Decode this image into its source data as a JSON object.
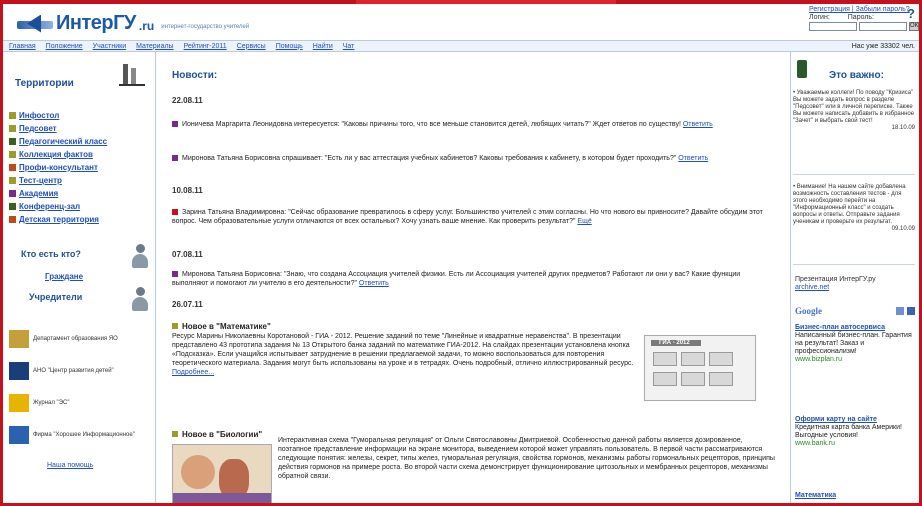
{
  "header": {
    "logo_text": "ИнтерГУ",
    "logo_tld": ".ru",
    "tagline": "интернет-государство учителей",
    "login": {
      "register_link": "Регистрация | Забыли пароль?",
      "login_label": "Логин:",
      "password_label": "Пароль:",
      "go_label": "OK"
    },
    "help_icon": "?"
  },
  "nav": {
    "items": [
      "Главная",
      "Положение",
      "Участники",
      "Материалы",
      "Рейтинг-2011",
      "Сервисы",
      "Помощь",
      "Найти",
      "Чат"
    ],
    "time": "Нас уже 33302 чел."
  },
  "left": {
    "territories_title": "Территории",
    "menu": [
      {
        "label": "Инфостол",
        "color": "#9c9c2a"
      },
      {
        "label": "Педсовет",
        "color": "#9c9c2a"
      },
      {
        "label": "Педагогический класс",
        "color": "#3b5f1e"
      },
      {
        "label": "Коллекция фактов",
        "color": "#9c9c2a"
      },
      {
        "label": "Профи-консультант",
        "color": "#c04a1a"
      },
      {
        "label": "Тест-центр",
        "color": "#9c9c2a"
      },
      {
        "label": "Академия",
        "color": "#7a2a8a"
      },
      {
        "label": "Конференц-зал",
        "color": "#3b5f1e"
      },
      {
        "label": "Детская территория",
        "color": "#c04a1a"
      }
    ],
    "who_is_who": "Кто есть кто?",
    "citizens": "Граждане",
    "founders": "Учредители",
    "partners": [
      {
        "text": "Департамент образования ЯО",
        "logo_color": "#c4a03a"
      },
      {
        "text": "АНО \"Центр развития детей\"",
        "logo_color": "#1b3d7a"
      },
      {
        "text": "Журнал \"ЭС\"",
        "logo_color": "#e8b400"
      },
      {
        "text": "Фирма \"Хорошее Информационное\"",
        "logo_color": "#2a62b0"
      }
    ],
    "help_link": "Наша помощь"
  },
  "main": {
    "news_title": "Новости:",
    "dates": [
      "22.08.11",
      "10.08.11",
      "07.08.11",
      "26.07.11"
    ],
    "items": [
      {
        "text": "Ионичева Маргарита Леонидовна интересуется: \"Каковы причины того, что все меньше становится детей, любящих читать?\" Ждет ответов по существу!",
        "link": "Ответить",
        "color": "#7a2a8a"
      },
      {
        "text": "Миронова Татьяна Борисовна спрашивает: \"Есть ли у вас аттестация учебных кабинетов? Каковы требования к кабинету, в котором будет проходить?\"",
        "link": "Ответить",
        "color": "#7a2a8a"
      },
      {
        "text": "Зарина Татьяна Владимировна: \"Сейчас образование превратилось в сферу услуг. Большинство учителей с этим согласны. Но что нового вы привносите? Давайте обсудим этот вопрос. Чем образовательные услуги отличаются от всех остальных? Хочу узнать ваше мнение. Как проверить результат?\"",
        "link": "Ещё",
        "color": "#c4121c"
      },
      {
        "text": "Миронова Татьяна Борисовна: \"Знаю, что создана Ассоциация учителей физики. Есть ли Ассоциация учителей других предметов? Работают ли они у вас? Какие функции выполняют и помогают ли учителю в его деятельности?\"",
        "link": "Ответить",
        "color": "#7a2a8a"
      }
    ],
    "novelty1": {
      "title": "Новое в \"Математике\"",
      "text": "Ресурс Марины Николаевны Коротановой - ГИА - 2012. Решение заданий по теме \"Линейные и квадратные неравенства\". В презентации представлено 43 прототипа задания № 13 Открытого банка заданий по математике ГИА-2012. На слайдах презентации установлена кнопка «Подсказка». Если учащийся испытывает затруднение в решении предлагаемой задачи, то можно воспользоваться для повторения теоретического материала. Задания могут быть использованы на уроке и в тетрадях. Очень подробный, отлично иллюстрированный ресурс.",
      "link": "Подробнее...",
      "thumb_title": "ГИА - 2012"
    },
    "novelty2": {
      "title": "Новое в \"Биологии\"",
      "text": "Интерактивная схема \"Гуморальная регуляция\" от Ольги Святославовны Дмитриевой. Особенностью данной работы является дозированное, поэтапное представление информации на экране монитора, выведением которой может управлять пользователь. В первой части рассматриваются следующие понятия: железы, секрет, типы желез, гуморальная регуляция, свойства гормонов, механизмы работы гормональных рецепторов, принципы действия гормонов на примере роста. Во второй части схема демонстрирует функционирование цитозольных и мембранных рецепторов, механизмы обратной связи."
    }
  },
  "right": {
    "title": "Это важно:",
    "notes": [
      {
        "text": "• Уважаемые коллеги! По поводу \"Кризиса\" Вы можете задать вопрос в разделе \"Педсовет\" или в личной переписке. Также Вы можете написать добавить в избранное \"Зачет\" и выбрать свой тест!",
        "date": "18.10.09"
      },
      {
        "text": "• Внимание! На нашем сайте добавлена возможность составления тестов - для этого необходимо перейти на \"Информационный класс\" и создать вопросы и ответы. Отправьте задания ученикам и проверьте их результат.",
        "date": "09.10.09"
      }
    ],
    "presentation": "Презентация ИнтерГУ.ру",
    "presentation_link": "archive.net",
    "google": "Google",
    "ads": [
      {
        "title": "Бизнес-план автосервиса",
        "body": "Написанный бизнес-план. Гарантия на результат! Заказ и профессионализм!",
        "url": "www.bizplan.ru"
      },
      {
        "title": "Оформи карту на сайте",
        "body": "Кредитная карта банка Америки! Выгодные условия!",
        "url": "www.bank.ru"
      },
      {
        "title": "Математика",
        "body": "",
        "url": ""
      }
    ]
  }
}
